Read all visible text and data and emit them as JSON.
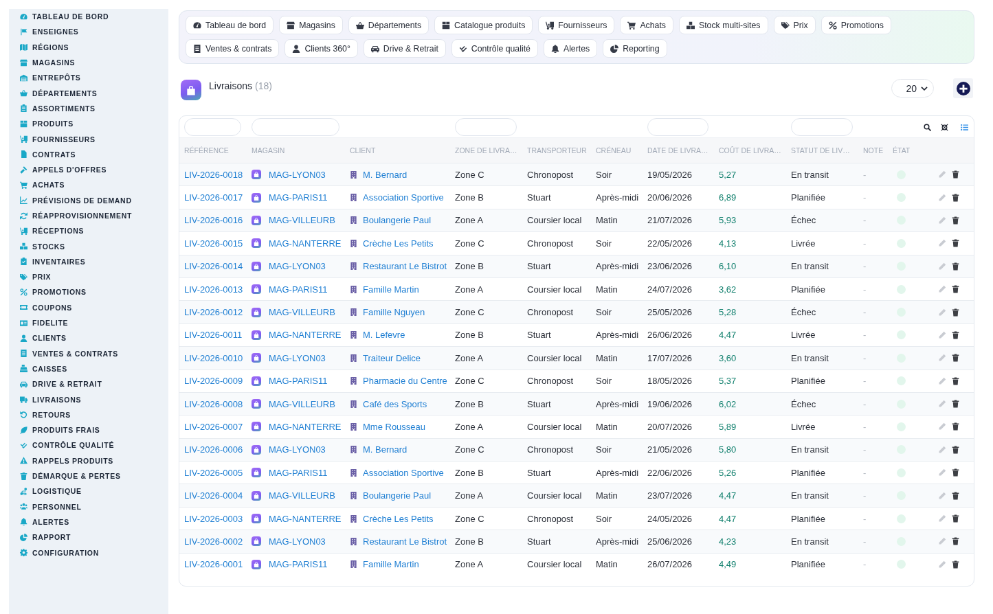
{
  "sidebar": {
    "items": [
      {
        "label": "TABLEAU DE BORD",
        "selected": false
      },
      {
        "label": "ENSEIGNES",
        "selected": false
      },
      {
        "label": "RÉGIONS",
        "selected": false
      },
      {
        "label": "MAGASINS",
        "selected": false
      },
      {
        "label": "ENTREPÔTS",
        "selected": false
      },
      {
        "label": "DÉPARTEMENTS",
        "selected": false
      },
      {
        "label": "ASSORTIMENTS",
        "selected": false
      },
      {
        "label": "PRODUITS",
        "selected": false
      },
      {
        "label": "FOURNISSEURS",
        "selected": false
      },
      {
        "label": "CONTRATS",
        "selected": false
      },
      {
        "label": "APPELS D'OFFRES",
        "selected": false
      },
      {
        "label": "ACHATS",
        "selected": false
      },
      {
        "label": "PRÉVISIONS DE DEMAND",
        "selected": false
      },
      {
        "label": "RÉAPPROVISIONNEMENT",
        "selected": false
      },
      {
        "label": "RÉCEPTIONS",
        "selected": false
      },
      {
        "label": "STOCKS",
        "selected": false
      },
      {
        "label": "INVENTAIRES",
        "selected": false
      },
      {
        "label": "PRIX",
        "selected": false
      },
      {
        "label": "PROMOTIONS",
        "selected": false
      },
      {
        "label": "COUPONS",
        "selected": false
      },
      {
        "label": "FIDELITE",
        "selected": false
      },
      {
        "label": "CLIENTS",
        "selected": false
      },
      {
        "label": "VENTES & CONTRATS",
        "selected": false
      },
      {
        "label": "CAISSES",
        "selected": false
      },
      {
        "label": "DRIVE & RETRAIT",
        "selected": false
      },
      {
        "label": "LIVRAISONS",
        "selected": false
      },
      {
        "label": "RETOURS",
        "selected": false
      },
      {
        "label": "PRODUITS FRAIS",
        "selected": false
      },
      {
        "label": "CONTRÔLE QUALITÉ",
        "selected": false
      },
      {
        "label": "RAPPELS PRODUITS",
        "selected": false
      },
      {
        "label": "DÉMARQUE & PERTES",
        "selected": false
      },
      {
        "label": "LOGISTIQUE",
        "selected": false
      },
      {
        "label": "PERSONNEL",
        "selected": false
      },
      {
        "label": "ALERTES",
        "selected": false
      },
      {
        "label": "RAPPORT",
        "selected": false
      },
      {
        "label": "CONFIGURATION",
        "selected": false
      }
    ]
  },
  "nav": {
    "rows": [
      {
        "tabs": [
          {
            "label": "Tableau de bord",
            "selected": false
          },
          {
            "label": "Magasins",
            "selected": false
          },
          {
            "label": "Départements",
            "selected": false
          },
          {
            "label": "Catalogue produits",
            "selected": false
          },
          {
            "label": "Fournisseurs",
            "selected": false
          },
          {
            "label": "Achats",
            "selected": false
          },
          {
            "label": "Stock multi-sites",
            "selected": false
          },
          {
            "label": "Prix",
            "selected": false
          },
          {
            "label": "Promotions",
            "selected": false
          }
        ]
      },
      {
        "tabs": [
          {
            "label": "Ventes & contrats",
            "selected": false
          },
          {
            "label": "Clients 360°",
            "selected": false
          },
          {
            "label": "Drive & Retrait",
            "selected": false
          },
          {
            "label": "Contrôle qualité",
            "selected": false
          },
          {
            "label": "Alertes",
            "selected": false
          },
          {
            "label": "Reporting",
            "selected": false
          }
        ]
      }
    ]
  },
  "header": {
    "title": "Livraisons",
    "count": "(18)",
    "page_size": "20"
  },
  "table": {
    "columns": [
      {
        "label": "RÉFÉRENCE",
        "filter": true
      },
      {
        "label": "MAGASIN",
        "filter": true
      },
      {
        "label": "CLIENT",
        "filter": false
      },
      {
        "label": "ZONE DE LIVRA…",
        "filter": true
      },
      {
        "label": "TRANSPORTEUR",
        "filter": false
      },
      {
        "label": "CRÉNEAU",
        "filter": false
      },
      {
        "label": "DATE DE LIVRA…",
        "filter": true
      },
      {
        "label": "COÛT DE LIVRA…",
        "filter": false
      },
      {
        "label": "STATUT DE LIV…",
        "filter": true
      },
      {
        "label": "NOTE",
        "filter": false
      },
      {
        "label": "ÉTAT",
        "filter": false
      }
    ],
    "rows": [
      {
        "reference": "LIV-2026-0018",
        "store": "MAG-LYON03",
        "client": "M. Bernard",
        "zone": "Zone C",
        "carrier": "Chronopost",
        "slot": "Soir",
        "date": "19/05/2026",
        "cost": "5,27",
        "status": "En transit",
        "note": "-",
        "color": "#e2f6ec"
      },
      {
        "reference": "LIV-2026-0017",
        "store": "MAG-PARIS11",
        "client": "Association Sportive",
        "zone": "Zone B",
        "carrier": "Stuart",
        "slot": "Après-midi",
        "date": "20/06/2026",
        "cost": "6,89",
        "status": "Planifiée",
        "note": "-",
        "color": "#e2f6ec"
      },
      {
        "reference": "LIV-2026-0016",
        "store": "MAG-VILLEURB",
        "client": "Boulangerie Paul",
        "zone": "Zone A",
        "carrier": "Coursier local",
        "slot": "Matin",
        "date": "21/07/2026",
        "cost": "5,93",
        "status": "Échec",
        "note": "-",
        "color": "#e2f6ec"
      },
      {
        "reference": "LIV-2026-0015",
        "store": "MAG-NANTERRE",
        "client": "Crèche Les Petits",
        "zone": "Zone C",
        "carrier": "Chronopost",
        "slot": "Soir",
        "date": "22/05/2026",
        "cost": "4,13",
        "status": "Livrée",
        "note": "-",
        "color": "#e2f6ec"
      },
      {
        "reference": "LIV-2026-0014",
        "store": "MAG-LYON03",
        "client": "Restaurant Le Bistrot",
        "zone": "Zone B",
        "carrier": "Stuart",
        "slot": "Après-midi",
        "date": "23/06/2026",
        "cost": "6,10",
        "status": "En transit",
        "note": "-",
        "color": "#e2f6ec"
      },
      {
        "reference": "LIV-2026-0013",
        "store": "MAG-PARIS11",
        "client": "Famille Martin",
        "zone": "Zone A",
        "carrier": "Coursier local",
        "slot": "Matin",
        "date": "24/07/2026",
        "cost": "3,62",
        "status": "Planifiée",
        "note": "-",
        "color": "#e2f6ec"
      },
      {
        "reference": "LIV-2026-0012",
        "store": "MAG-VILLEURB",
        "client": "Famille Nguyen",
        "zone": "Zone C",
        "carrier": "Chronopost",
        "slot": "Soir",
        "date": "25/05/2026",
        "cost": "5,28",
        "status": "Échec",
        "note": "-",
        "color": "#e2f6ec"
      },
      {
        "reference": "LIV-2026-0011",
        "store": "MAG-NANTERRE",
        "client": "M. Lefevre",
        "zone": "Zone B",
        "carrier": "Stuart",
        "slot": "Après-midi",
        "date": "26/06/2026",
        "cost": "4,47",
        "status": "Livrée",
        "note": "-",
        "color": "#e2f6ec"
      },
      {
        "reference": "LIV-2026-0010",
        "store": "MAG-LYON03",
        "client": "Traiteur Delice",
        "zone": "Zone A",
        "carrier": "Coursier local",
        "slot": "Matin",
        "date": "17/07/2026",
        "cost": "3,60",
        "status": "En transit",
        "note": "-",
        "color": "#e2f6ec"
      },
      {
        "reference": "LIV-2026-0009",
        "store": "MAG-PARIS11",
        "client": "Pharmacie du Centre",
        "zone": "Zone C",
        "carrier": "Chronopost",
        "slot": "Soir",
        "date": "18/05/2026",
        "cost": "5,37",
        "status": "Planifiée",
        "note": "-",
        "color": "#e2f6ec"
      },
      {
        "reference": "LIV-2026-0008",
        "store": "MAG-VILLEURB",
        "client": "Café des Sports",
        "zone": "Zone B",
        "carrier": "Stuart",
        "slot": "Après-midi",
        "date": "19/06/2026",
        "cost": "6,02",
        "status": "Échec",
        "note": "-",
        "color": "#e2f6ec"
      },
      {
        "reference": "LIV-2026-0007",
        "store": "MAG-NANTERRE",
        "client": "Mme Rousseau",
        "zone": "Zone A",
        "carrier": "Coursier local",
        "slot": "Matin",
        "date": "20/07/2026",
        "cost": "5,89",
        "status": "Livrée",
        "note": "-",
        "color": "#e2f6ec"
      },
      {
        "reference": "LIV-2026-0006",
        "store": "MAG-LYON03",
        "client": "M. Bernard",
        "zone": "Zone C",
        "carrier": "Chronopost",
        "slot": "Soir",
        "date": "21/05/2026",
        "cost": "5,80",
        "status": "En transit",
        "note": "-",
        "color": "#e2f6ec"
      },
      {
        "reference": "LIV-2026-0005",
        "store": "MAG-PARIS11",
        "client": "Association Sportive",
        "zone": "Zone B",
        "carrier": "Stuart",
        "slot": "Après-midi",
        "date": "22/06/2026",
        "cost": "5,26",
        "status": "Planifiée",
        "note": "-",
        "color": "#e2f6ec"
      },
      {
        "reference": "LIV-2026-0004",
        "store": "MAG-VILLEURB",
        "client": "Boulangerie Paul",
        "zone": "Zone A",
        "carrier": "Coursier local",
        "slot": "Matin",
        "date": "23/07/2026",
        "cost": "4,47",
        "status": "En transit",
        "note": "-",
        "color": "#e2f6ec"
      },
      {
        "reference": "LIV-2026-0003",
        "store": "MAG-NANTERRE",
        "client": "Crèche Les Petits",
        "zone": "Zone C",
        "carrier": "Chronopost",
        "slot": "Soir",
        "date": "24/05/2026",
        "cost": "4,47",
        "status": "Planifiée",
        "note": "-",
        "color": "#e2f6ec"
      },
      {
        "reference": "LIV-2026-0002",
        "store": "MAG-LYON03",
        "client": "Restaurant Le Bistrot",
        "zone": "Zone B",
        "carrier": "Stuart",
        "slot": "Après-midi",
        "date": "25/06/2026",
        "cost": "4,23",
        "status": "En transit",
        "note": "-",
        "color": "#e2f6ec"
      },
      {
        "reference": "LIV-2026-0001",
        "store": "MAG-PARIS11",
        "client": "Famille Martin",
        "zone": "Zone A",
        "carrier": "Coursier local",
        "slot": "Matin",
        "date": "26/07/2026",
        "cost": "4,49",
        "status": "Planifiée",
        "note": "-",
        "color": "#e2f6ec"
      }
    ]
  }
}
